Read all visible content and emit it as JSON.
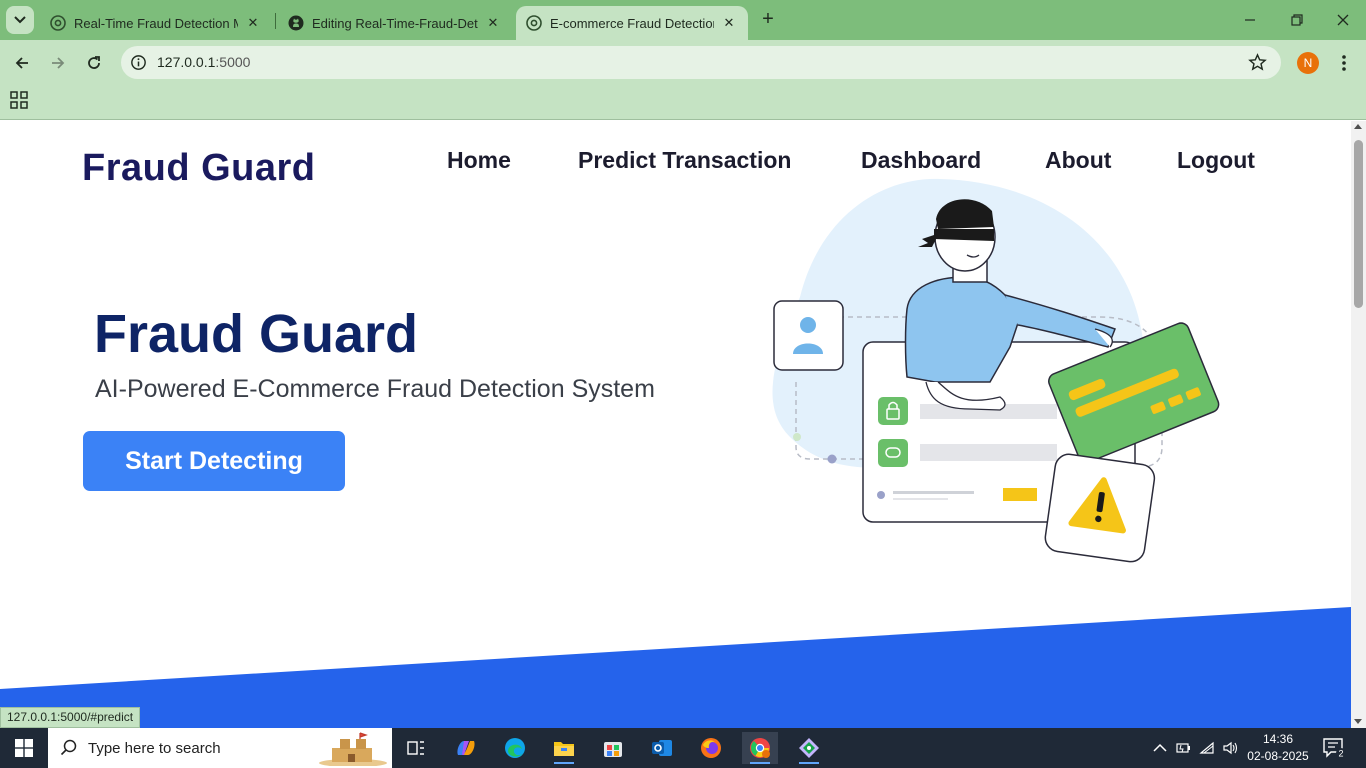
{
  "browser": {
    "tabs": [
      {
        "title": "Real-Time Fraud Detection ML",
        "favicon": "chrome-icon"
      },
      {
        "title": "Editing Real-Time-Fraud-Detect",
        "favicon": "github-icon"
      },
      {
        "title": "E-commerce Fraud Detection",
        "favicon": "chrome-icon",
        "active": true
      }
    ],
    "url_host": "127.0.0.1",
    "url_port": ":5000",
    "profile_initial": "N",
    "status_url": "127.0.0.1:5000/#predict"
  },
  "page": {
    "brand": "Fraud Guard",
    "nav": [
      "Home",
      "Predict Transaction",
      "Dashboard",
      "About",
      "Logout"
    ],
    "hero_title": "Fraud Guard",
    "hero_subtitle": "AI-Powered E-Commerce Fraud Detection System",
    "cta_label": "Start Detecting",
    "colors": {
      "brand": "#1a1a5e",
      "accent": "#3b82f6",
      "wave": "#2563eb",
      "card": "#6abf69"
    }
  },
  "taskbar": {
    "search_placeholder": "Type here to search",
    "apps": [
      "task-view-icon",
      "copilot-icon",
      "edge-icon",
      "file-explorer-icon",
      "store-icon",
      "outlook-icon",
      "firefox-icon",
      "chrome-icon",
      "git-icon"
    ],
    "time": "14:36",
    "date": "02-08-2025",
    "notifications": "2"
  }
}
